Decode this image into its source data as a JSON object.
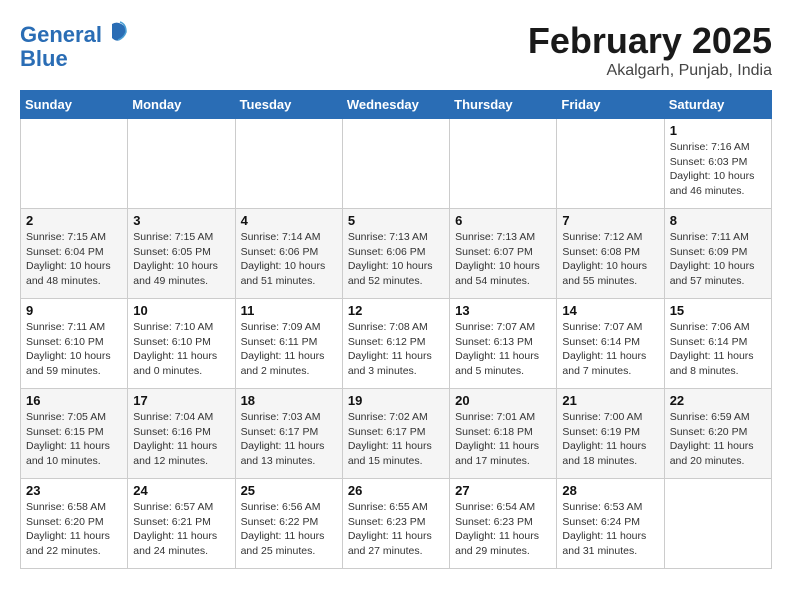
{
  "logo": {
    "line1": "General",
    "line2": "Blue"
  },
  "title": "February 2025",
  "location": "Akalgarh, Punjab, India",
  "weekdays": [
    "Sunday",
    "Monday",
    "Tuesday",
    "Wednesday",
    "Thursday",
    "Friday",
    "Saturday"
  ],
  "weeks": [
    [
      {
        "day": "",
        "info": ""
      },
      {
        "day": "",
        "info": ""
      },
      {
        "day": "",
        "info": ""
      },
      {
        "day": "",
        "info": ""
      },
      {
        "day": "",
        "info": ""
      },
      {
        "day": "",
        "info": ""
      },
      {
        "day": "1",
        "info": "Sunrise: 7:16 AM\nSunset: 6:03 PM\nDaylight: 10 hours and 46 minutes."
      }
    ],
    [
      {
        "day": "2",
        "info": "Sunrise: 7:15 AM\nSunset: 6:04 PM\nDaylight: 10 hours and 48 minutes."
      },
      {
        "day": "3",
        "info": "Sunrise: 7:15 AM\nSunset: 6:05 PM\nDaylight: 10 hours and 49 minutes."
      },
      {
        "day": "4",
        "info": "Sunrise: 7:14 AM\nSunset: 6:06 PM\nDaylight: 10 hours and 51 minutes."
      },
      {
        "day": "5",
        "info": "Sunrise: 7:13 AM\nSunset: 6:06 PM\nDaylight: 10 hours and 52 minutes."
      },
      {
        "day": "6",
        "info": "Sunrise: 7:13 AM\nSunset: 6:07 PM\nDaylight: 10 hours and 54 minutes."
      },
      {
        "day": "7",
        "info": "Sunrise: 7:12 AM\nSunset: 6:08 PM\nDaylight: 10 hours and 55 minutes."
      },
      {
        "day": "8",
        "info": "Sunrise: 7:11 AM\nSunset: 6:09 PM\nDaylight: 10 hours and 57 minutes."
      }
    ],
    [
      {
        "day": "9",
        "info": "Sunrise: 7:11 AM\nSunset: 6:10 PM\nDaylight: 10 hours and 59 minutes."
      },
      {
        "day": "10",
        "info": "Sunrise: 7:10 AM\nSunset: 6:10 PM\nDaylight: 11 hours and 0 minutes."
      },
      {
        "day": "11",
        "info": "Sunrise: 7:09 AM\nSunset: 6:11 PM\nDaylight: 11 hours and 2 minutes."
      },
      {
        "day": "12",
        "info": "Sunrise: 7:08 AM\nSunset: 6:12 PM\nDaylight: 11 hours and 3 minutes."
      },
      {
        "day": "13",
        "info": "Sunrise: 7:07 AM\nSunset: 6:13 PM\nDaylight: 11 hours and 5 minutes."
      },
      {
        "day": "14",
        "info": "Sunrise: 7:07 AM\nSunset: 6:14 PM\nDaylight: 11 hours and 7 minutes."
      },
      {
        "day": "15",
        "info": "Sunrise: 7:06 AM\nSunset: 6:14 PM\nDaylight: 11 hours and 8 minutes."
      }
    ],
    [
      {
        "day": "16",
        "info": "Sunrise: 7:05 AM\nSunset: 6:15 PM\nDaylight: 11 hours and 10 minutes."
      },
      {
        "day": "17",
        "info": "Sunrise: 7:04 AM\nSunset: 6:16 PM\nDaylight: 11 hours and 12 minutes."
      },
      {
        "day": "18",
        "info": "Sunrise: 7:03 AM\nSunset: 6:17 PM\nDaylight: 11 hours and 13 minutes."
      },
      {
        "day": "19",
        "info": "Sunrise: 7:02 AM\nSunset: 6:17 PM\nDaylight: 11 hours and 15 minutes."
      },
      {
        "day": "20",
        "info": "Sunrise: 7:01 AM\nSunset: 6:18 PM\nDaylight: 11 hours and 17 minutes."
      },
      {
        "day": "21",
        "info": "Sunrise: 7:00 AM\nSunset: 6:19 PM\nDaylight: 11 hours and 18 minutes."
      },
      {
        "day": "22",
        "info": "Sunrise: 6:59 AM\nSunset: 6:20 PM\nDaylight: 11 hours and 20 minutes."
      }
    ],
    [
      {
        "day": "23",
        "info": "Sunrise: 6:58 AM\nSunset: 6:20 PM\nDaylight: 11 hours and 22 minutes."
      },
      {
        "day": "24",
        "info": "Sunrise: 6:57 AM\nSunset: 6:21 PM\nDaylight: 11 hours and 24 minutes."
      },
      {
        "day": "25",
        "info": "Sunrise: 6:56 AM\nSunset: 6:22 PM\nDaylight: 11 hours and 25 minutes."
      },
      {
        "day": "26",
        "info": "Sunrise: 6:55 AM\nSunset: 6:23 PM\nDaylight: 11 hours and 27 minutes."
      },
      {
        "day": "27",
        "info": "Sunrise: 6:54 AM\nSunset: 6:23 PM\nDaylight: 11 hours and 29 minutes."
      },
      {
        "day": "28",
        "info": "Sunrise: 6:53 AM\nSunset: 6:24 PM\nDaylight: 11 hours and 31 minutes."
      },
      {
        "day": "",
        "info": ""
      }
    ]
  ]
}
